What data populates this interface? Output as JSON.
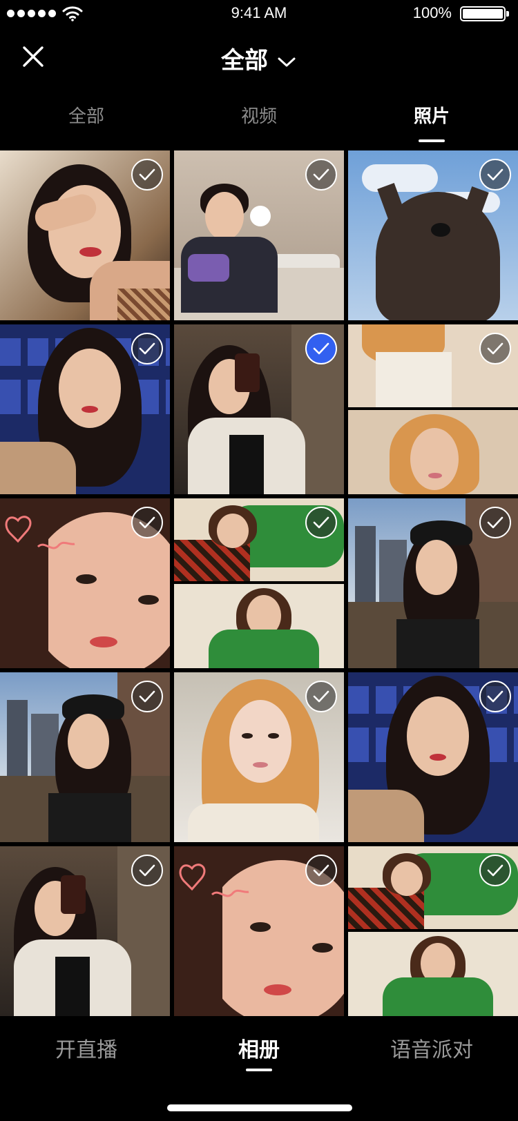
{
  "status_bar": {
    "time": "9:41 AM",
    "battery": "100%"
  },
  "header": {
    "title": "全部"
  },
  "tabs": [
    {
      "label": "全部",
      "active": false
    },
    {
      "label": "视频",
      "active": false
    },
    {
      "label": "照片",
      "active": true
    }
  ],
  "photos": [
    {
      "subject": "woman-hand-on-face",
      "selected": false
    },
    {
      "subject": "man-on-couch-holding-toy",
      "selected": false
    },
    {
      "subject": "dog-against-sky",
      "selected": false
    },
    {
      "subject": "girl-in-theater-seats",
      "selected": false
    },
    {
      "subject": "girl-mirror-selfie",
      "selected": true
    },
    {
      "subject": "blonde-girl-collage",
      "selected": false
    },
    {
      "subject": "girl-closeup-heart-doodle",
      "selected": false
    },
    {
      "subject": "woman-green-jacket-collage",
      "selected": false
    },
    {
      "subject": "girl-beret-city-bridge",
      "selected": false
    },
    {
      "subject": "girl-beret-city-bridge",
      "selected": false
    },
    {
      "subject": "blonde-girl-portrait",
      "selected": false
    },
    {
      "subject": "girl-in-theater-seats",
      "selected": false
    },
    {
      "subject": "girl-mirror-selfie",
      "selected": false
    },
    {
      "subject": "girl-closeup-heart-doodle",
      "selected": false
    },
    {
      "subject": "woman-green-jacket-collage",
      "selected": false
    }
  ],
  "bottom_tabs": [
    {
      "label": "开直播",
      "active": false
    },
    {
      "label": "相册",
      "active": true
    },
    {
      "label": "语音派对",
      "active": false
    }
  ],
  "colors": {
    "background": "#000000",
    "selected_check": "#3260f0",
    "inactive_text": "#8c8c8c"
  }
}
